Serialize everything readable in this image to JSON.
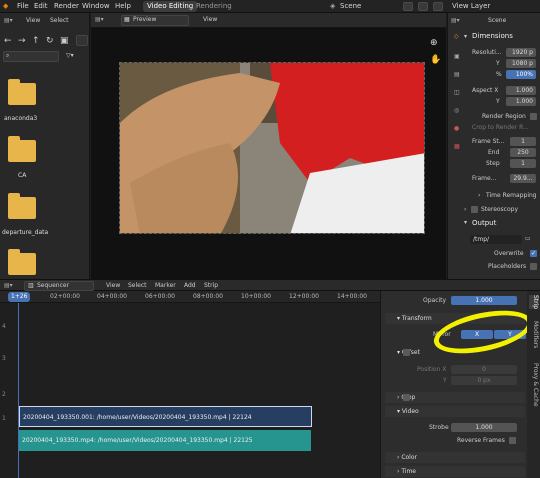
{
  "menu": {
    "file": "File",
    "edit": "Edit",
    "render": "Render",
    "window": "Window",
    "help": "Help"
  },
  "workspaces": {
    "active": "Video Editing",
    "other": "Rendering"
  },
  "scene": {
    "name": "Scene",
    "view_layer": "View Layer"
  },
  "filebrowser": {
    "view": "View",
    "select": "Select",
    "items": [
      {
        "label": "anaconda3"
      },
      {
        "label": "CA"
      },
      {
        "label": "departure_data"
      }
    ]
  },
  "preview": {
    "mode": "Preview",
    "view": "View"
  },
  "props": {
    "scene_label": "Scene",
    "dimensions": "Dimensions",
    "res_x_label": "Resoluti...",
    "res_x": "1920 p",
    "res_y_label": "Y",
    "res_y": "1080 p",
    "res_pct_label": "%",
    "res_pct": "100%",
    "aspect_x_label": "Aspect X",
    "aspect_x": "1.000",
    "aspect_y_label": "Y",
    "aspect_y": "1.000",
    "render_region": "Render Region",
    "crop_region": "Crop to Render R...",
    "frame_start_label": "Frame St...",
    "frame_start": "1",
    "frame_end_label": "End",
    "frame_end": "250",
    "step_label": "Step",
    "step": "1",
    "frame_rate_label": "Frame...",
    "frame_rate": "29.9...",
    "time_remapping": "Time Remapping",
    "stereoscopy": "Stereoscopy",
    "output": "Output",
    "output_path": "/tmp/",
    "overwrite": "Overwrite",
    "placeholders": "Placeholders"
  },
  "sequencer": {
    "editor": "Sequencer",
    "menus": {
      "view": "View",
      "select": "Select",
      "marker": "Marker",
      "add": "Add",
      "strip": "Strip"
    },
    "current_frame": "1+26",
    "ticks": [
      "02+00:00",
      "04+00:00",
      "06+00:00",
      "08+00:00",
      "10+00:00",
      "12+00:00",
      "14+00:00"
    ],
    "strip1": "20200404_193350.001: /home/user/Videos/20200404_193350.mp4 | 22124",
    "strip2": "20200404_193350.mp4: /home/user/Videos/20200404_193350.mp4 | 22125"
  },
  "strip_props": {
    "opacity_label": "Opacity",
    "opacity": "1.000",
    "transform": "Transform",
    "mirror_label": "Mirror",
    "mirror_x": "X",
    "mirror_y": "Y",
    "offset": "Offset",
    "position_x_label": "Position X",
    "position_x": "0",
    "position_y_label": "Y",
    "position_y": "0 px",
    "crop": "Crop",
    "video": "Video",
    "strobe_label": "Strobe",
    "strobe": "1.000",
    "reverse_frames": "Reverse Frames",
    "color": "Color",
    "time": "Time",
    "tabs": {
      "strip": "Strip",
      "modifiers": "Modifiers",
      "proxy": "Proxy & Cache"
    }
  },
  "colors": {
    "accent": "#4772b3",
    "strip_blue": "#263e62",
    "strip_teal": "#26958f",
    "highlight": "#f2f200"
  }
}
